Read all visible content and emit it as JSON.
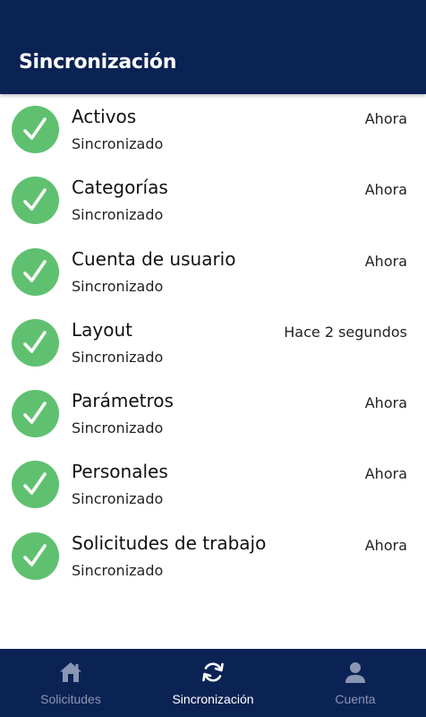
{
  "header": {
    "title": "Sincronización"
  },
  "sync_items": [
    {
      "title": "Activos",
      "status": "Sincronizado",
      "time": "Ahora",
      "icon": "check-icon"
    },
    {
      "title": "Categorías",
      "status": "Sincronizado",
      "time": "Ahora",
      "icon": "check-icon"
    },
    {
      "title": "Cuenta de usuario",
      "status": "Sincronizado",
      "time": "Ahora",
      "icon": "check-icon"
    },
    {
      "title": "Layout",
      "status": "Sincronizado",
      "time": "Hace 2 segundos",
      "icon": "check-icon"
    },
    {
      "title": "Parámetros",
      "status": "Sincronizado",
      "time": "Ahora",
      "icon": "check-icon"
    },
    {
      "title": "Personales",
      "status": "Sincronizado",
      "time": "Ahora",
      "icon": "check-icon"
    },
    {
      "title": "Solicitudes de trabajo",
      "status": "Sincronizado",
      "time": "Ahora",
      "icon": "check-icon"
    }
  ],
  "bottom_nav": {
    "items": [
      {
        "label": "Solicitudes",
        "icon": "home-icon",
        "active": false
      },
      {
        "label": "Sincronización",
        "icon": "sync-icon",
        "active": true
      },
      {
        "label": "Cuenta",
        "icon": "person-icon",
        "active": false
      }
    ]
  },
  "colors": {
    "header_bg": "#0b2354",
    "success_green": "#5fc170",
    "nav_inactive": "#8a96b3",
    "nav_active": "#ffffff"
  }
}
